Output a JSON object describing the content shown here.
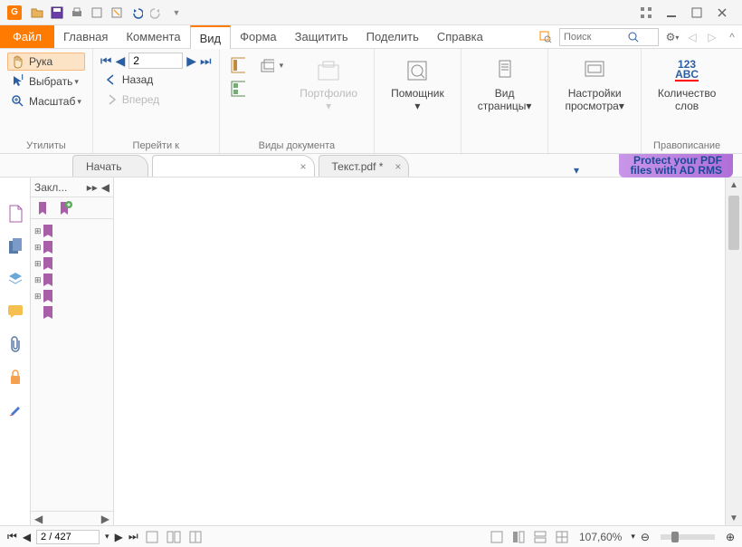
{
  "titlebar": {
    "title": ""
  },
  "tabs": {
    "file": "Файл",
    "items": [
      "Главная",
      "Коммента",
      "Вид",
      "Форма",
      "Защитить",
      "Поделить",
      "Справка"
    ],
    "active_index": 2,
    "search_placeholder": "Поиск"
  },
  "ribbon": {
    "utilities": {
      "label": "Утилиты",
      "hand": "Рука",
      "select": "Выбрать",
      "zoom": "Масштаб"
    },
    "goto": {
      "label": "Перейти к",
      "page_value": "2",
      "back": "Назад",
      "forward": "Вперед"
    },
    "doc_views": {
      "label": "Виды документа",
      "portfolio": "Портфолио"
    },
    "assistant": {
      "label": "Помощник"
    },
    "page_view": {
      "label": "Вид",
      "label2": "страницы"
    },
    "view_settings": {
      "label": "Настройки",
      "label2": "просмотра"
    },
    "spell": {
      "group_label": "Правописание",
      "label": "Количество",
      "label2": "слов",
      "icon_text": "123",
      "icon_text2": "ABC"
    }
  },
  "doctabs": {
    "items": [
      {
        "label": "Начать",
        "closeable": false
      },
      {
        "label": " ",
        "closeable": true
      },
      {
        "label": "Текст.pdf *",
        "closeable": true
      }
    ],
    "ad_line1": "Protect your PDF",
    "ad_line2": "files with AD RMS"
  },
  "panel": {
    "title": "Закл...",
    "items": [
      " ",
      " ",
      " ",
      " ",
      " ",
      " "
    ]
  },
  "statusbar": {
    "page": "2 / 427",
    "zoom": "107,60%"
  }
}
